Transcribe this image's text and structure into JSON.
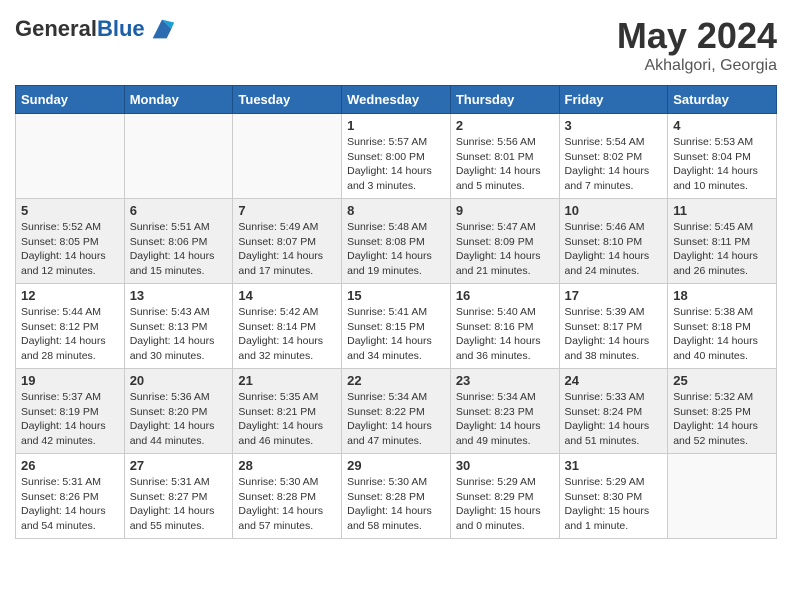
{
  "header": {
    "logo_general": "General",
    "logo_blue": "Blue",
    "month": "May 2024",
    "location": "Akhalgori, Georgia"
  },
  "weekdays": [
    "Sunday",
    "Monday",
    "Tuesday",
    "Wednesday",
    "Thursday",
    "Friday",
    "Saturday"
  ],
  "weeks": [
    [
      {
        "day": "",
        "info": ""
      },
      {
        "day": "",
        "info": ""
      },
      {
        "day": "",
        "info": ""
      },
      {
        "day": "1",
        "info": "Sunrise: 5:57 AM\nSunset: 8:00 PM\nDaylight: 14 hours\nand 3 minutes."
      },
      {
        "day": "2",
        "info": "Sunrise: 5:56 AM\nSunset: 8:01 PM\nDaylight: 14 hours\nand 5 minutes."
      },
      {
        "day": "3",
        "info": "Sunrise: 5:54 AM\nSunset: 8:02 PM\nDaylight: 14 hours\nand 7 minutes."
      },
      {
        "day": "4",
        "info": "Sunrise: 5:53 AM\nSunset: 8:04 PM\nDaylight: 14 hours\nand 10 minutes."
      }
    ],
    [
      {
        "day": "5",
        "info": "Sunrise: 5:52 AM\nSunset: 8:05 PM\nDaylight: 14 hours\nand 12 minutes."
      },
      {
        "day": "6",
        "info": "Sunrise: 5:51 AM\nSunset: 8:06 PM\nDaylight: 14 hours\nand 15 minutes."
      },
      {
        "day": "7",
        "info": "Sunrise: 5:49 AM\nSunset: 8:07 PM\nDaylight: 14 hours\nand 17 minutes."
      },
      {
        "day": "8",
        "info": "Sunrise: 5:48 AM\nSunset: 8:08 PM\nDaylight: 14 hours\nand 19 minutes."
      },
      {
        "day": "9",
        "info": "Sunrise: 5:47 AM\nSunset: 8:09 PM\nDaylight: 14 hours\nand 21 minutes."
      },
      {
        "day": "10",
        "info": "Sunrise: 5:46 AM\nSunset: 8:10 PM\nDaylight: 14 hours\nand 24 minutes."
      },
      {
        "day": "11",
        "info": "Sunrise: 5:45 AM\nSunset: 8:11 PM\nDaylight: 14 hours\nand 26 minutes."
      }
    ],
    [
      {
        "day": "12",
        "info": "Sunrise: 5:44 AM\nSunset: 8:12 PM\nDaylight: 14 hours\nand 28 minutes."
      },
      {
        "day": "13",
        "info": "Sunrise: 5:43 AM\nSunset: 8:13 PM\nDaylight: 14 hours\nand 30 minutes."
      },
      {
        "day": "14",
        "info": "Sunrise: 5:42 AM\nSunset: 8:14 PM\nDaylight: 14 hours\nand 32 minutes."
      },
      {
        "day": "15",
        "info": "Sunrise: 5:41 AM\nSunset: 8:15 PM\nDaylight: 14 hours\nand 34 minutes."
      },
      {
        "day": "16",
        "info": "Sunrise: 5:40 AM\nSunset: 8:16 PM\nDaylight: 14 hours\nand 36 minutes."
      },
      {
        "day": "17",
        "info": "Sunrise: 5:39 AM\nSunset: 8:17 PM\nDaylight: 14 hours\nand 38 minutes."
      },
      {
        "day": "18",
        "info": "Sunrise: 5:38 AM\nSunset: 8:18 PM\nDaylight: 14 hours\nand 40 minutes."
      }
    ],
    [
      {
        "day": "19",
        "info": "Sunrise: 5:37 AM\nSunset: 8:19 PM\nDaylight: 14 hours\nand 42 minutes."
      },
      {
        "day": "20",
        "info": "Sunrise: 5:36 AM\nSunset: 8:20 PM\nDaylight: 14 hours\nand 44 minutes."
      },
      {
        "day": "21",
        "info": "Sunrise: 5:35 AM\nSunset: 8:21 PM\nDaylight: 14 hours\nand 46 minutes."
      },
      {
        "day": "22",
        "info": "Sunrise: 5:34 AM\nSunset: 8:22 PM\nDaylight: 14 hours\nand 47 minutes."
      },
      {
        "day": "23",
        "info": "Sunrise: 5:34 AM\nSunset: 8:23 PM\nDaylight: 14 hours\nand 49 minutes."
      },
      {
        "day": "24",
        "info": "Sunrise: 5:33 AM\nSunset: 8:24 PM\nDaylight: 14 hours\nand 51 minutes."
      },
      {
        "day": "25",
        "info": "Sunrise: 5:32 AM\nSunset: 8:25 PM\nDaylight: 14 hours\nand 52 minutes."
      }
    ],
    [
      {
        "day": "26",
        "info": "Sunrise: 5:31 AM\nSunset: 8:26 PM\nDaylight: 14 hours\nand 54 minutes."
      },
      {
        "day": "27",
        "info": "Sunrise: 5:31 AM\nSunset: 8:27 PM\nDaylight: 14 hours\nand 55 minutes."
      },
      {
        "day": "28",
        "info": "Sunrise: 5:30 AM\nSunset: 8:28 PM\nDaylight: 14 hours\nand 57 minutes."
      },
      {
        "day": "29",
        "info": "Sunrise: 5:30 AM\nSunset: 8:28 PM\nDaylight: 14 hours\nand 58 minutes."
      },
      {
        "day": "30",
        "info": "Sunrise: 5:29 AM\nSunset: 8:29 PM\nDaylight: 15 hours\nand 0 minutes."
      },
      {
        "day": "31",
        "info": "Sunrise: 5:29 AM\nSunset: 8:30 PM\nDaylight: 15 hours\nand 1 minute."
      },
      {
        "day": "",
        "info": ""
      }
    ]
  ]
}
